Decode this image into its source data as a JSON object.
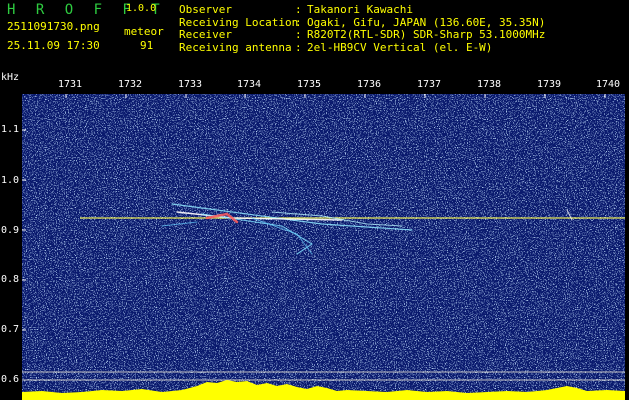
{
  "header": {
    "logo": "H R O F F T",
    "version": "1.0.0",
    "filename": "2511091730.png",
    "datetime": "25.11.09 17:30",
    "meteor_label": "meteor",
    "meteor_count": "91",
    "info_rows": [
      {
        "key": "Observer",
        "value": "Takanori Kawachi"
      },
      {
        "key": "Receiving Location",
        "value": "Ogaki, Gifu, JAPAN (136.60E, 35.35N)"
      },
      {
        "key": "Receiver",
        "value": "R820T2(RTL-SDR) SDR-Sharp 53.1000MHz"
      },
      {
        "key": "Receiving antenna",
        "value": "2el-HB9CV Vertical (el. E-W)"
      }
    ]
  },
  "axes": {
    "y_unit": "kHz",
    "y_ticks": [
      "1.1",
      "1.0",
      "0.9",
      "0.8",
      "0.7",
      "0.6"
    ],
    "x_ticks": [
      "1731",
      "1732",
      "1733",
      "1734",
      "1735",
      "1736",
      "1737",
      "1738",
      "1739",
      "1740"
    ]
  },
  "colors": {
    "background": "#0a1a6e",
    "text_yellow": "#ffff00",
    "logo_green": "#2ecc40",
    "carrier": "#ffff55"
  }
}
